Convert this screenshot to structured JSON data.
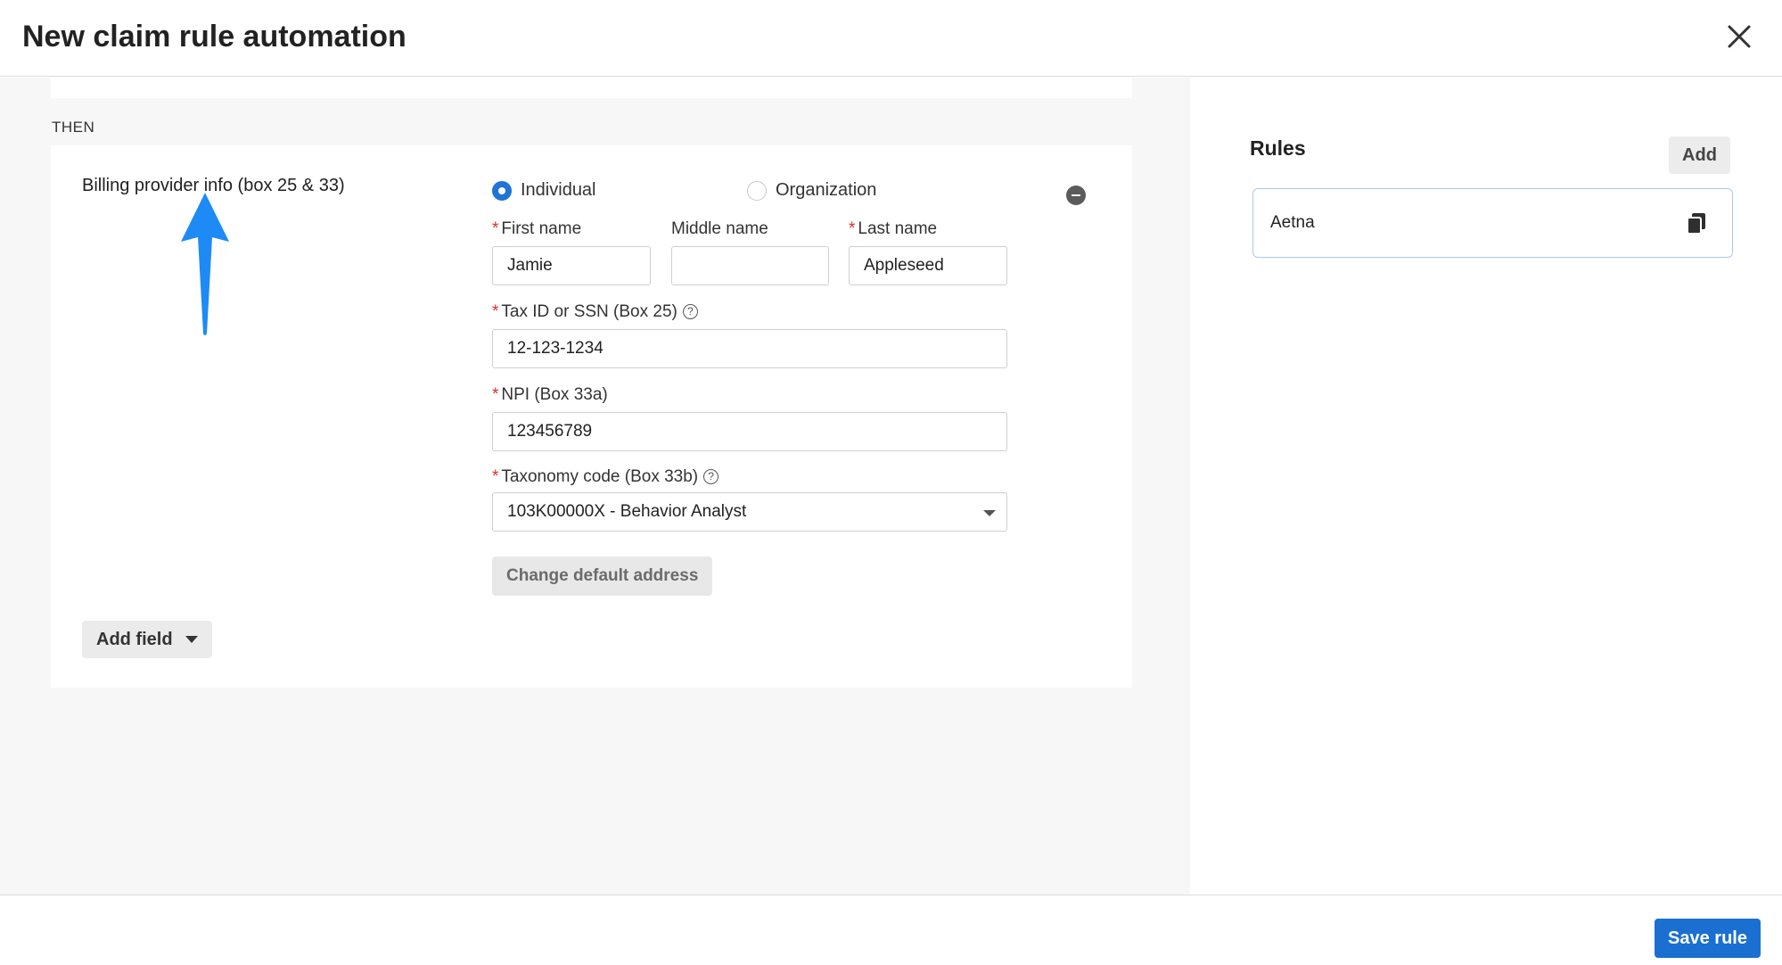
{
  "header": {
    "title": "New claim rule automation"
  },
  "then_label": "THEN",
  "billing": {
    "section_label": "Billing provider info (box 25 & 33)",
    "radio_individual": "Individual",
    "radio_organization": "Organization",
    "selected": "Individual",
    "first_name_label": "First name",
    "first_name_value": "Jamie",
    "middle_name_label": "Middle name",
    "middle_name_value": "",
    "last_name_label": "Last name",
    "last_name_value": "Appleseed",
    "tax_label": "Tax ID or SSN (Box 25)",
    "tax_value": "12-123-1234",
    "npi_label": "NPI (Box 33a)",
    "npi_value": "123456789",
    "taxonomy_label": "Taxonomy code (Box 33b)",
    "taxonomy_value": "103K00000X - Behavior Analyst",
    "change_address_label": "Change default address",
    "required_mark": "*",
    "help_mark": "?"
  },
  "add_field_label": "Add field",
  "rules": {
    "title": "Rules",
    "add_label": "Add",
    "items": [
      {
        "name": "Aetna"
      }
    ]
  },
  "footer": {
    "save_label": "Save rule"
  },
  "colors": {
    "accent": "#1a6fd0",
    "arrow": "#1e8af5",
    "required": "#d93025"
  },
  "icons": {
    "close": "close-icon",
    "copy": "copy-icon",
    "remove": "minus-circle-icon",
    "help": "question-circle-icon",
    "annotation": "up-arrow-icon"
  }
}
